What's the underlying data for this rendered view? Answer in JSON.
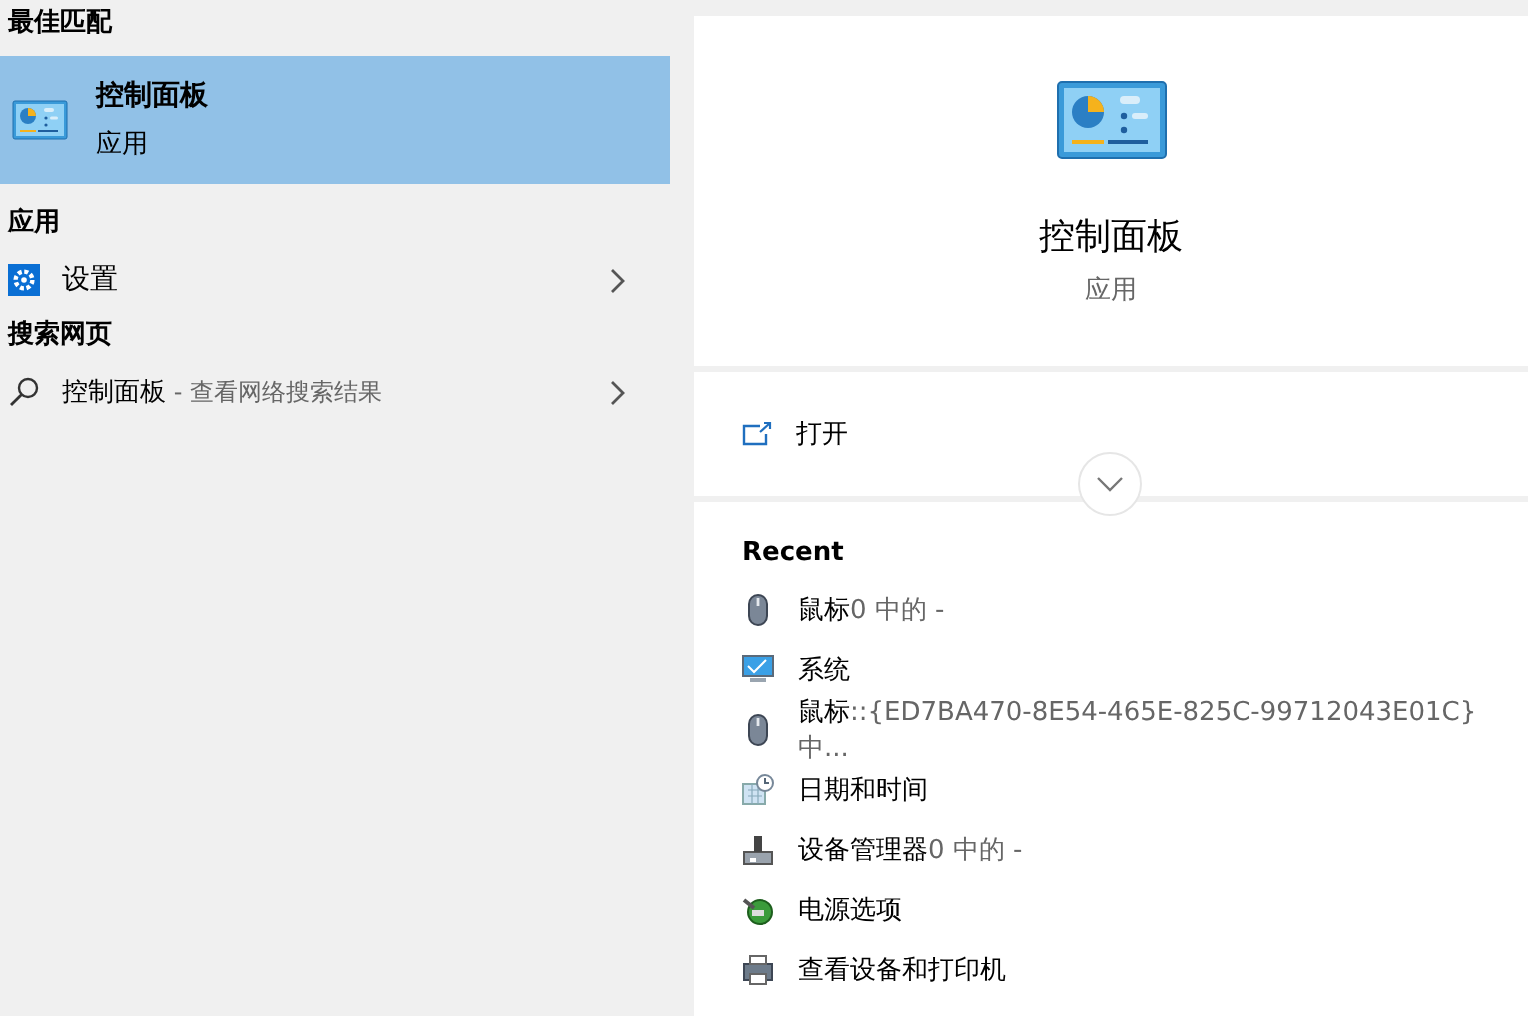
{
  "results": {
    "sections": [
      {
        "heading": "最佳匹配",
        "items": [
          {
            "kind": "app",
            "title": "控制面板",
            "subtitle": "应用",
            "selected": true
          }
        ]
      },
      {
        "heading": "应用",
        "items": [
          {
            "kind": "settings",
            "title": "设置",
            "selected": false
          }
        ]
      },
      {
        "heading": "搜索网页",
        "items": [
          {
            "kind": "web",
            "title": "控制面板",
            "suffix": " - 查看网络搜索结果",
            "selected": false
          }
        ]
      }
    ]
  },
  "detail": {
    "title": "控制面板",
    "subtitle": "应用",
    "actions": [
      {
        "kind": "open",
        "label": "打开"
      }
    ],
    "recent": {
      "heading": "Recent",
      "items": [
        {
          "kind": "mouse",
          "name": "鼠标",
          "detail": "0 中的 -"
        },
        {
          "kind": "monitor",
          "name": "系统"
        },
        {
          "kind": "mouse",
          "name": "鼠标",
          "detail": "::{ED7BA470-8E54-465E-825C-99712043E01C} 中..."
        },
        {
          "kind": "clock",
          "name": "日期和时间"
        },
        {
          "kind": "device",
          "name": "设备管理器",
          "detail": "0 中的 -"
        },
        {
          "kind": "power",
          "name": "电源选项"
        },
        {
          "kind": "printer",
          "name": "查看设备和打印机"
        }
      ]
    }
  }
}
